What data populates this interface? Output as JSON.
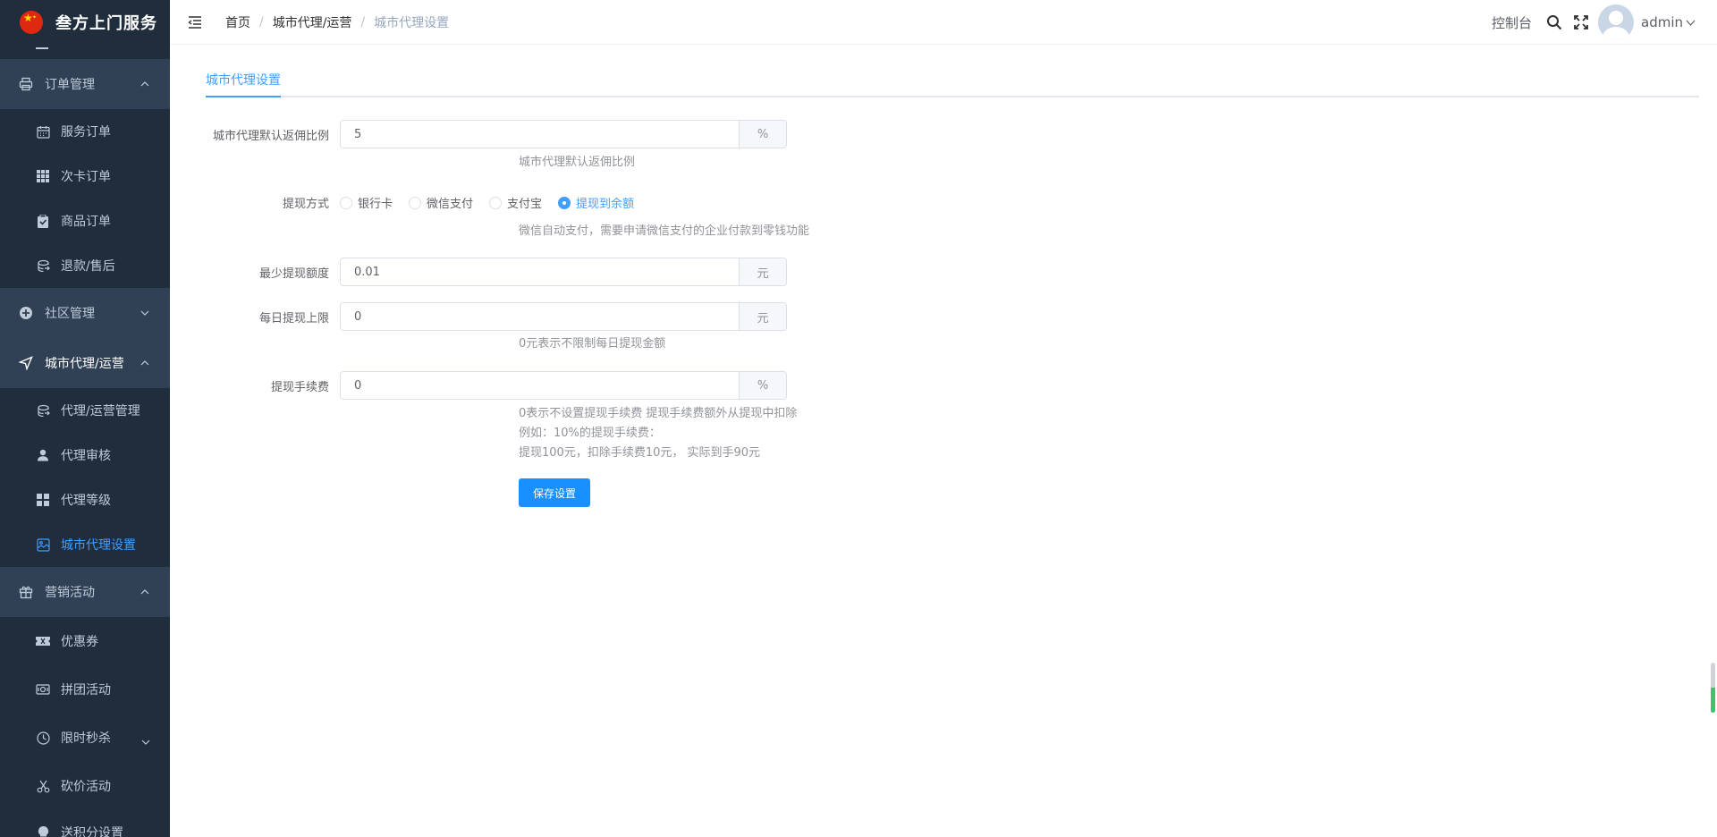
{
  "app": {
    "title": "叁方上门服务"
  },
  "sidebar": {
    "groups": [
      {
        "label": "订单管理",
        "items": [
          {
            "label": "服务订单",
            "icon": "calendar-icon"
          },
          {
            "label": "次卡订单",
            "icon": "grid-icon"
          },
          {
            "label": "商品订单",
            "icon": "clipboard-icon"
          },
          {
            "label": "退款/售后",
            "icon": "refund-icon"
          }
        ]
      },
      {
        "label": "社区管理",
        "items": []
      },
      {
        "label": "城市代理/运营",
        "items": [
          {
            "label": "代理/运营管理",
            "icon": "refund-icon"
          },
          {
            "label": "代理审核",
            "icon": "user-icon"
          },
          {
            "label": "代理等级",
            "icon": "grid-icon"
          },
          {
            "label": "城市代理设置",
            "icon": "picture-icon",
            "active": true
          }
        ]
      },
      {
        "label": "营销活动",
        "items": [
          {
            "label": "优惠券",
            "icon": "ticket-icon"
          },
          {
            "label": "拼团活动",
            "icon": "money-icon"
          },
          {
            "label": "限时秒杀",
            "icon": "clock-icon"
          },
          {
            "label": "砍价活动",
            "icon": "scissors-icon"
          },
          {
            "label": "送积分设置",
            "icon": "lightbulb-icon"
          }
        ]
      }
    ]
  },
  "header": {
    "breadcrumb": [
      "首页",
      "城市代理/运营",
      "城市代理设置"
    ],
    "console": "控制台",
    "user": "admin"
  },
  "tabs": [
    "城市代理设置"
  ],
  "form": {
    "commission": {
      "label": "城市代理默认返佣比例",
      "value": "5",
      "suffix": "%",
      "hint": "城市代理默认返佣比例"
    },
    "withdraw_method": {
      "label": "提现方式",
      "options": [
        "银行卡",
        "微信支付",
        "支付宝",
        "提现到余额"
      ],
      "selected": "提现到余额",
      "hint": "微信自动支付，需要申请微信支付的企业付款到零钱功能"
    },
    "min_withdraw": {
      "label": "最少提现额度",
      "value": "0.01",
      "suffix": "元"
    },
    "daily_limit": {
      "label": "每日提现上限",
      "value": "0",
      "suffix": "元",
      "hint": "0元表示不限制每日提现金额"
    },
    "fee": {
      "label": "提现手续费",
      "value": "0",
      "suffix": "%",
      "hint_lines": [
        "0表示不设置提现手续费 提现手续费额外从提现中扣除",
        "例如：10%的提现手续费：",
        "提现100元，扣除手续费10元， 实际到手90元"
      ]
    },
    "save_label": "保存设置"
  },
  "colors": {
    "primary": "#409eff",
    "sidebar_bg": "#304156",
    "sidebar_sub_bg": "#1f2d3d",
    "button": "#1890ff"
  }
}
